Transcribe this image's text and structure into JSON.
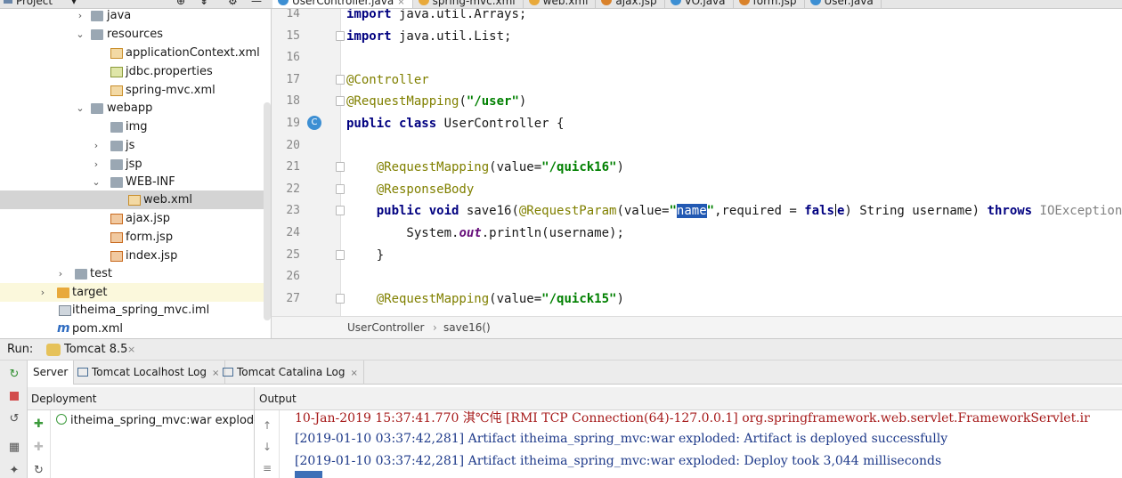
{
  "project_header": {
    "label": "Project",
    "dropdown_glyph": "▾",
    "icons": [
      "globe-icon",
      "collapse-icon",
      "gear-icon",
      "hide-icon"
    ]
  },
  "tabs": [
    {
      "label": "UserController.java",
      "icon": "class-icon",
      "icon_color": "#3d8fd3",
      "active": true
    },
    {
      "label": "spring-mvc.xml",
      "icon": "xml-icon",
      "icon_color": "#e8a93b"
    },
    {
      "label": "web.xml",
      "icon": "xml-icon",
      "icon_color": "#e8a93b"
    },
    {
      "label": "ajax.jsp",
      "icon": "jsp-icon",
      "icon_color": "#d9822b"
    },
    {
      "label": "VO.java",
      "icon": "class-icon",
      "icon_color": "#3d8fd3"
    },
    {
      "label": "form.jsp",
      "icon": "jsp-icon",
      "icon_color": "#d9822b"
    },
    {
      "label": "User.java",
      "icon": "class-icon",
      "icon_color": "#3d8fd3"
    }
  ],
  "tree": {
    "items": [
      {
        "label": "java",
        "arrow": "›"
      },
      {
        "label": "resources",
        "arrow": "⌄"
      },
      {
        "label": "applicationContext.xml"
      },
      {
        "label": "jdbc.properties"
      },
      {
        "label": "spring-mvc.xml"
      },
      {
        "label": "webapp",
        "arrow": "⌄"
      },
      {
        "label": "img"
      },
      {
        "label": "js",
        "arrow": "›"
      },
      {
        "label": "jsp",
        "arrow": "›"
      },
      {
        "label": "WEB-INF",
        "arrow": "⌄"
      },
      {
        "label": "web.xml"
      },
      {
        "label": "ajax.jsp"
      },
      {
        "label": "form.jsp"
      },
      {
        "label": "index.jsp"
      },
      {
        "label": "test",
        "arrow": "›"
      },
      {
        "label": "target",
        "arrow": "›"
      },
      {
        "label": "itheima_spring_mvc.iml"
      },
      {
        "label": "pom.xml",
        "prefix": "m"
      }
    ]
  },
  "editor": {
    "lines": [
      {
        "n": "14",
        "parts": [
          {
            "t": "import",
            "c": "kw"
          },
          {
            "t": " java.util.Arrays;"
          }
        ]
      },
      {
        "n": "15",
        "parts": [
          {
            "t": "import",
            "c": "kw"
          },
          {
            "t": " java.util.List;"
          }
        ]
      },
      {
        "n": "16",
        "parts": []
      },
      {
        "n": "17",
        "parts": [
          {
            "t": "@Controller",
            "c": "an"
          }
        ]
      },
      {
        "n": "18",
        "parts": [
          {
            "t": "@RequestMapping",
            "c": "an"
          },
          {
            "t": "("
          },
          {
            "t": "\"/user\"",
            "c": "st"
          },
          {
            "t": ")"
          }
        ]
      },
      {
        "n": "19",
        "parts": [
          {
            "t": "public class",
            "c": "kw"
          },
          {
            "t": " UserController {"
          }
        ]
      },
      {
        "n": "20",
        "parts": []
      },
      {
        "n": "21",
        "parts": [
          {
            "t": "    "
          },
          {
            "t": "@RequestMapping",
            "c": "an"
          },
          {
            "t": "(value="
          },
          {
            "t": "\"/quick16\"",
            "c": "st"
          },
          {
            "t": ")"
          }
        ]
      },
      {
        "n": "22",
        "parts": [
          {
            "t": "    "
          },
          {
            "t": "@ResponseBody",
            "c": "an"
          }
        ]
      },
      {
        "n": "23",
        "parts": [
          {
            "t": "    "
          },
          {
            "t": "public void",
            "c": "kw"
          },
          {
            "t": " save16("
          },
          {
            "t": "@RequestParam",
            "c": "an"
          },
          {
            "t": "(value="
          },
          {
            "t": "\"",
            "c": "st"
          },
          {
            "t": "name",
            "c": "selword"
          },
          {
            "t": "\"",
            "c": "st"
          },
          {
            "t": ",required = "
          },
          {
            "t": "fals",
            "c": "kw"
          },
          {
            "t": "",
            "c": "caret"
          },
          {
            "t": "e",
            "c": "kw"
          },
          {
            "t": ") String username) "
          },
          {
            "t": "throws",
            "c": "kw"
          },
          {
            "t": " "
          },
          {
            "t": "IOException",
            "c": "ex"
          },
          {
            "t": " {"
          }
        ]
      },
      {
        "n": "24",
        "parts": [
          {
            "t": "        System."
          },
          {
            "t": "out",
            "c": "it"
          },
          {
            "t": ".println(username);"
          }
        ]
      },
      {
        "n": "25",
        "parts": [
          {
            "t": "    }"
          }
        ]
      },
      {
        "n": "26",
        "parts": []
      },
      {
        "n": "27",
        "parts": [
          {
            "t": "    "
          },
          {
            "t": "@RequestMapping",
            "c": "an"
          },
          {
            "t": "(value="
          },
          {
            "t": "\"/quick15\"",
            "c": "st"
          },
          {
            "t": ")"
          }
        ]
      }
    ]
  },
  "breadcrumb": {
    "class": "UserController",
    "sep": "›",
    "method": "save16()"
  },
  "run": {
    "label": "Run:",
    "config": "Tomcat 8.5",
    "close": "×",
    "sub_tabs": [
      {
        "label": "Server",
        "active": true
      },
      {
        "label": "Tomcat Localhost Log",
        "close": "×"
      },
      {
        "label": "Tomcat Catalina Log",
        "close": "×"
      }
    ],
    "deployment_header": "Deployment",
    "output_header": "Output",
    "deployment_item": "itheima_spring_mvc:war exploded",
    "log": [
      "10-Jan-2019 15:37:41.770 淇℃伅 [RMI TCP Connection(64)-127.0.0.1] org.springframework.web.servlet.FrameworkServlet.ir",
      "[2019-01-10 03:37:42,281] Artifact itheima_spring_mvc:war exploded: Artifact is deployed successfully",
      "[2019-01-10 03:37:42,281] Artifact itheima_spring_mvc:war exploded: Deploy took 3,044 milliseconds"
    ]
  },
  "colors": {
    "accent": "#2259b3",
    "keyword": "#000080",
    "annotation": "#808000",
    "string": "#008000",
    "log_error": "#a61a1a"
  }
}
